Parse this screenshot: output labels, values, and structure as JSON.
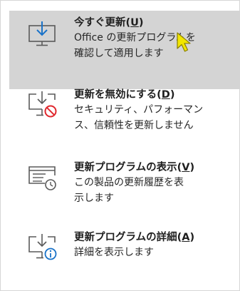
{
  "menu": {
    "items": [
      {
        "title": "今すぐ更新",
        "accel": "U",
        "description_lines": [
          "Office の更新プログラムを",
          "確認して適用します"
        ],
        "icon": "download-monitor-icon",
        "hovered": true
      },
      {
        "title": "更新を無効にする",
        "accel": "D",
        "description_lines": [
          "セキュリティ、パフォーマン",
          "ス、信頼性を更新しません"
        ],
        "icon": "update-disabled-icon",
        "hovered": false
      },
      {
        "title": "更新プログラムの表示",
        "accel": "V",
        "description_lines": [
          "この製品の更新履歴を表",
          "示します"
        ],
        "icon": "update-history-icon",
        "hovered": false
      },
      {
        "title": "更新プログラムの詳細",
        "accel": "A",
        "description_lines": [
          "詳細を表示します"
        ],
        "icon": "update-info-icon",
        "hovered": false
      }
    ]
  },
  "colors": {
    "hover_background": "#d4d4d4",
    "icon_blue": "#1a73c9",
    "icon_gray": "#5a5a5a",
    "disable_red": "#e0282e",
    "cursor_yellow": "#f2e600"
  }
}
